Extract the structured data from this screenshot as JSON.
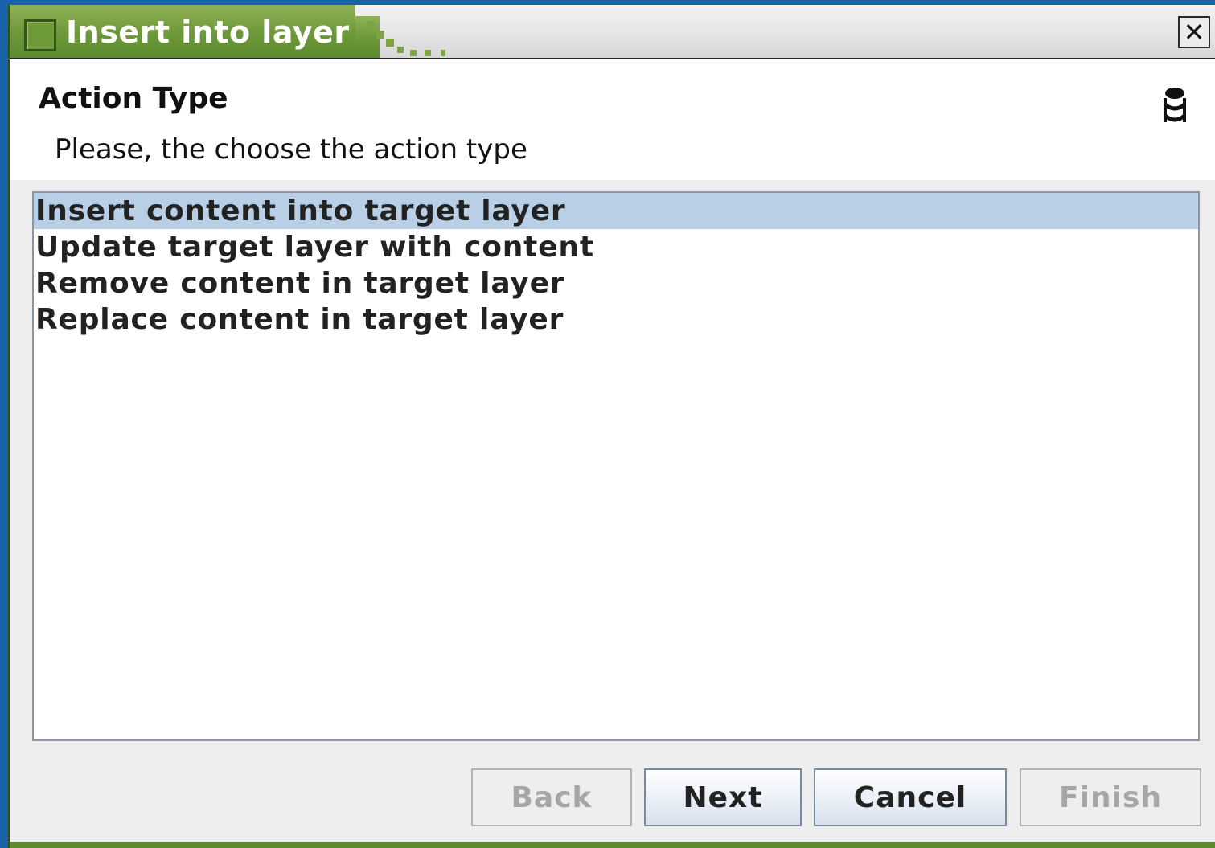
{
  "window": {
    "title": "Insert into layer",
    "close_label": "✕"
  },
  "header": {
    "title": "Action Type",
    "subtitle": "Please, the choose the action type",
    "icon": "database-icon"
  },
  "list": {
    "items": [
      {
        "label": "Insert content into target layer",
        "selected": true
      },
      {
        "label": "Update target layer with content",
        "selected": false
      },
      {
        "label": "Remove content in target layer",
        "selected": false
      },
      {
        "label": "Replace content in target layer",
        "selected": false
      }
    ]
  },
  "buttons": {
    "back": {
      "label": "Back",
      "enabled": false
    },
    "next": {
      "label": "Next",
      "enabled": true
    },
    "cancel": {
      "label": "Cancel",
      "enabled": true
    },
    "finish": {
      "label": "Finish",
      "enabled": false
    }
  },
  "colors": {
    "desktop": "#1a62a8",
    "title_accent": "#5c8a2e",
    "selection": "#b8cfe5"
  }
}
